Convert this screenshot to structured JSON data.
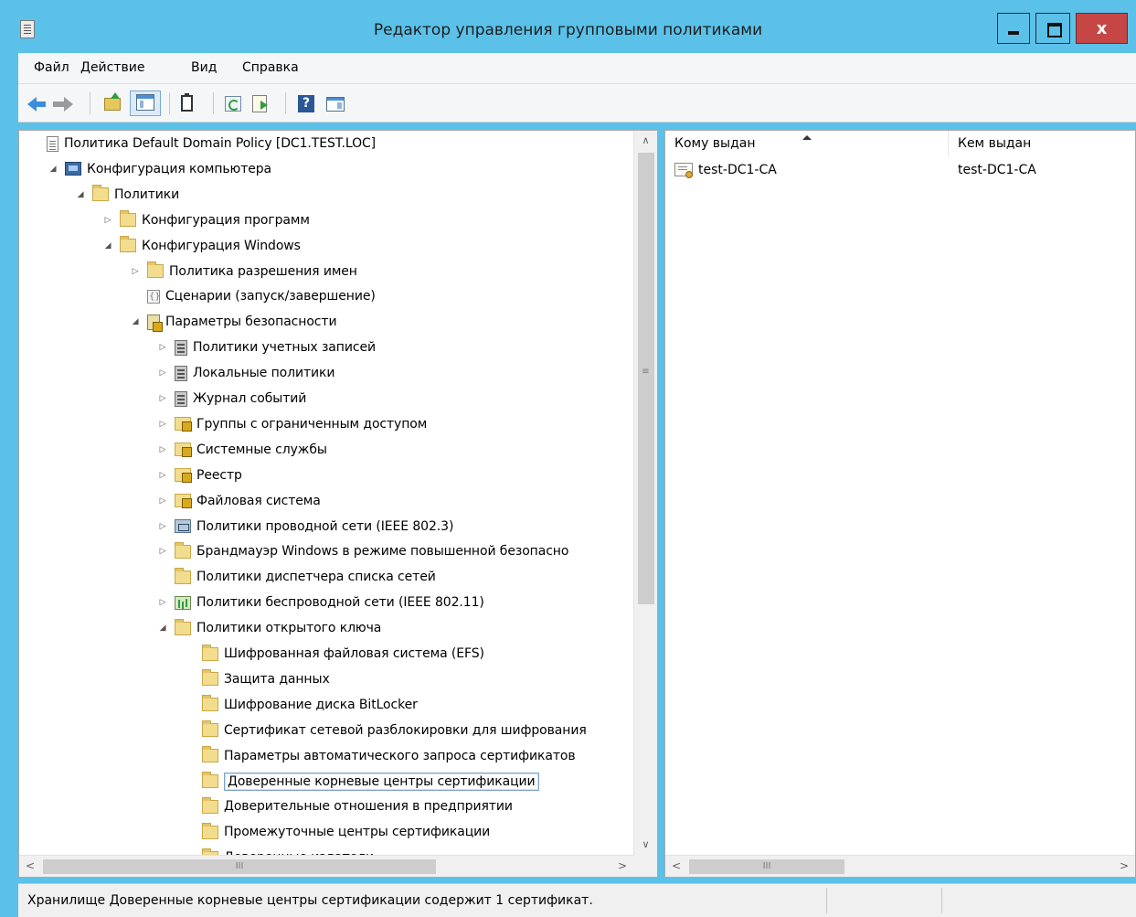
{
  "window": {
    "title": "Редактор управления групповыми политиками",
    "close_glyph": "x"
  },
  "menu": {
    "items": [
      "Файл",
      "Действие",
      "Вид",
      "Справка"
    ]
  },
  "toolbar": {
    "icons": [
      "back-arrow-icon",
      "forward-arrow-icon",
      "folder-up-icon",
      "show-hide-tree-icon",
      "clipboard-icon",
      "refresh-icon",
      "export-list-icon",
      "help-icon",
      "action-pane-icon"
    ]
  },
  "tree": {
    "items": [
      {
        "label": "Политика Default Domain Policy [DC1.TEST.LOC]",
        "expander": "",
        "icon": "document-icon"
      },
      {
        "label": "Конфигурация компьютера",
        "expander": "◢",
        "icon": "computer-icon"
      },
      {
        "label": "Политики",
        "expander": "◢",
        "icon": "folder-icon"
      },
      {
        "label": "Конфигурация программ",
        "expander": "▷",
        "icon": "folder-icon"
      },
      {
        "label": "Конфигурация Windows",
        "expander": "◢",
        "icon": "folder-icon"
      },
      {
        "label": "Политика разрешения имен",
        "expander": "▷",
        "icon": "folder-icon"
      },
      {
        "label": "Сценарии (запуск/завершение)",
        "expander": "",
        "icon": "script-icon"
      },
      {
        "label": "Параметры безопасности",
        "expander": "◢",
        "icon": "security-settings-icon"
      },
      {
        "label": "Политики учетных записей",
        "expander": "▷",
        "icon": "account-policy-icon"
      },
      {
        "label": "Локальные политики",
        "expander": "▷",
        "icon": "server-policy-icon"
      },
      {
        "label": "Журнал событий",
        "expander": "▷",
        "icon": "server-policy-icon"
      },
      {
        "label": "Группы с ограниченным доступом",
        "expander": "▷",
        "icon": "locked-folder-icon"
      },
      {
        "label": "Системные службы",
        "expander": "▷",
        "icon": "locked-folder-icon"
      },
      {
        "label": "Реестр",
        "expander": "▷",
        "icon": "locked-folder-icon"
      },
      {
        "label": "Файловая система",
        "expander": "▷",
        "icon": "locked-folder-icon"
      },
      {
        "label": "Политики проводной сети (IEEE 802.3)",
        "expander": "▷",
        "icon": "wired-network-icon"
      },
      {
        "label": "Брандмауэр Windows в режиме повышенной безопасно",
        "expander": "▷",
        "icon": "folder-icon"
      },
      {
        "label": "Политики диспетчера списка сетей",
        "expander": "",
        "icon": "folder-icon"
      },
      {
        "label": "Политики беспроводной сети (IEEE 802.11)",
        "expander": "▷",
        "icon": "wireless-network-icon"
      },
      {
        "label": "Политики открытого ключа",
        "expander": "◢",
        "icon": "folder-icon"
      },
      {
        "label": "Шифрованная файловая система (EFS)",
        "expander": "",
        "icon": "folder-icon"
      },
      {
        "label": "Защита данных",
        "expander": "",
        "icon": "folder-icon"
      },
      {
        "label": "Шифрование диска BitLocker",
        "expander": "",
        "icon": "folder-icon"
      },
      {
        "label": "Сертификат сетевой разблокировки для шифрования",
        "expander": "",
        "icon": "folder-icon"
      },
      {
        "label": "Параметры автоматического запроса сертификатов",
        "expander": "",
        "icon": "folder-icon"
      },
      {
        "label": "Доверенные корневые центры сертификации",
        "expander": "",
        "icon": "folder-icon",
        "selected": true
      },
      {
        "label": "Доверительные отношения в предприятии",
        "expander": "",
        "icon": "folder-icon"
      },
      {
        "label": "Промежуточные центры сертификации",
        "expander": "",
        "icon": "folder-icon"
      },
      {
        "label": "Доверенные издатели",
        "expander": "",
        "icon": "folder-icon"
      }
    ]
  },
  "scroll": {
    "up": "∧",
    "down": "∨",
    "left": "<",
    "right": ">",
    "grip_v": "≡",
    "grip_h": "III"
  },
  "list": {
    "columns": [
      "Кому выдан",
      "Кем выдан"
    ],
    "rows": [
      {
        "issued_to": "test-DC1-CA",
        "issued_by": "test-DC1-CA"
      }
    ]
  },
  "status": {
    "text": "Хранилище Доверенные корневые центры сертификации содержит 1 сертификат."
  },
  "colors": {
    "titlebar": "#5bc1e8",
    "close_button": "#c64646"
  }
}
